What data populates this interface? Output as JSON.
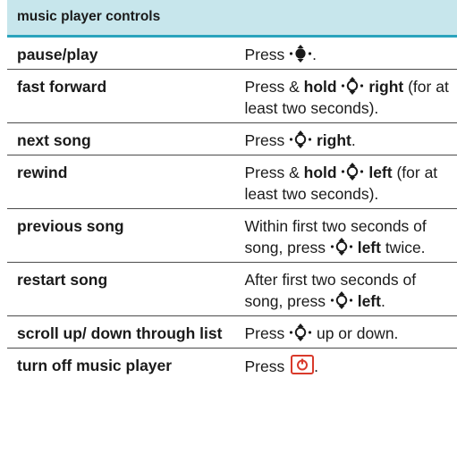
{
  "header": {
    "title": "music player controls"
  },
  "rows": [
    {
      "label": "pause/play",
      "parts": [
        "Press ",
        "."
      ]
    },
    {
      "label": "fast forward",
      "parts": [
        "Press & ",
        "hold",
        "right",
        "(for at least two seconds)."
      ]
    },
    {
      "label": "next song",
      "parts": [
        "Press ",
        "right",
        "."
      ]
    },
    {
      "label": "rewind",
      "parts": [
        "Press & ",
        "hold",
        "left",
        "(for at least two seconds)."
      ]
    },
    {
      "label": "previous song",
      "parts": [
        "Within first two seconds of song, press ",
        "left",
        " twice."
      ]
    },
    {
      "label": "restart song",
      "parts": [
        "After first two seconds of song, press ",
        "left",
        "."
      ]
    },
    {
      "label": "scroll up/ down through list",
      "parts": [
        "Press ",
        " up or down."
      ]
    },
    {
      "label": "turn off music player",
      "parts": [
        "Press ",
        "."
      ]
    }
  ],
  "icons": {
    "nav_key": "navigation-key-icon",
    "nav_center": "navigation-key-center-icon",
    "end_key": "power-end-key-icon"
  },
  "colors": {
    "header_bg": "#c7e6ec",
    "header_rule": "#2aa3bd",
    "end_key": "#d93a2b"
  }
}
